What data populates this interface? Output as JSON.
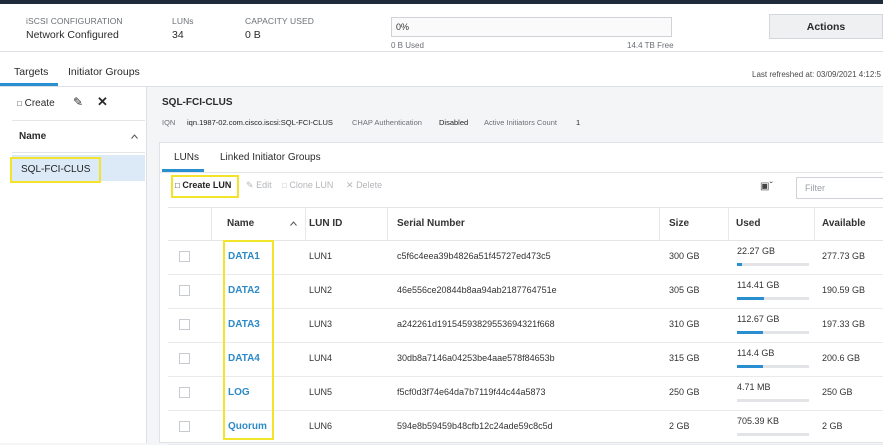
{
  "header": {
    "iscsi_label": "iSCSI CONFIGURATION",
    "iscsi_value": "Network Configured",
    "luns_label": "LUNs",
    "luns_value": "34",
    "capacity_label": "CAPACITY USED",
    "capacity_value": "0 B",
    "capacity_percent": "0%",
    "capacity_used": "0 B Used",
    "capacity_free": "14.4 TB Free",
    "actions_label": "Actions"
  },
  "tabs": [
    "Targets",
    "Initiator Groups"
  ],
  "last_refreshed": "Last refreshed at: 03/09/2021 4:12:5",
  "left_panel": {
    "create_label": "Create",
    "column_header": "Name",
    "items": [
      "SQL-FCI-CLUS"
    ]
  },
  "target": {
    "name": "SQL-FCI-CLUS",
    "iqn_label": "IQN",
    "iqn_value": "iqn.1987-02.com.cisco.iscsi:SQL-FCI-CLUS",
    "chap_label": "CHAP Authentication",
    "chap_value": "Disabled",
    "initiators_label": "Active Initiators Count",
    "initiators_value": "1"
  },
  "subtabs": [
    "LUNs",
    "Linked Initiator Groups"
  ],
  "toolbar": {
    "create_lun": "Create LUN",
    "edit": "Edit",
    "clone_lun": "Clone LUN",
    "delete": "Delete",
    "filter_placeholder": "Filter"
  },
  "table": {
    "columns": [
      "Name",
      "LUN ID",
      "Serial Number",
      "Size",
      "Used",
      "Available"
    ],
    "rows": [
      {
        "name": "DATA1",
        "lun_id": "LUN1",
        "serial": "c5f6c4eea39b4826a51f45727ed473c5",
        "size": "300 GB",
        "used": "22.27 GB",
        "used_fraction": 0.07,
        "available": "277.73 GB"
      },
      {
        "name": "DATA2",
        "lun_id": "LUN2",
        "serial": "46e556ce20844b8aa94ab2187764751e",
        "size": "305 GB",
        "used": "114.41 GB",
        "used_fraction": 0.38,
        "available": "190.59 GB"
      },
      {
        "name": "DATA3",
        "lun_id": "LUN3",
        "serial": "a242261d19154593829553694321f668",
        "size": "310 GB",
        "used": "112.67 GB",
        "used_fraction": 0.36,
        "available": "197.33 GB"
      },
      {
        "name": "DATA4",
        "lun_id": "LUN4",
        "serial": "30db8a7146a04253be4aae578f84653b",
        "size": "315 GB",
        "used": "114.4 GB",
        "used_fraction": 0.36,
        "available": "200.6 GB"
      },
      {
        "name": "LOG",
        "lun_id": "LUN5",
        "serial": "f5cf0d3f74e64da7b7119f44c44a5873",
        "size": "250 GB",
        "used": "4.71 MB",
        "used_fraction": 0.0,
        "available": "250 GB"
      },
      {
        "name": "Quorum",
        "lun_id": "LUN6",
        "serial": "594e8b59459b48cfb12c24ade59c8c5d",
        "size": "2 GB",
        "used": "705.39 KB",
        "used_fraction": 0.0,
        "available": "2 GB"
      }
    ]
  },
  "colors": {
    "accent": "#2a8fd0",
    "link": "#2d8ac7",
    "highlight": "#f1e42b",
    "selected_row": "#dceaf7"
  }
}
